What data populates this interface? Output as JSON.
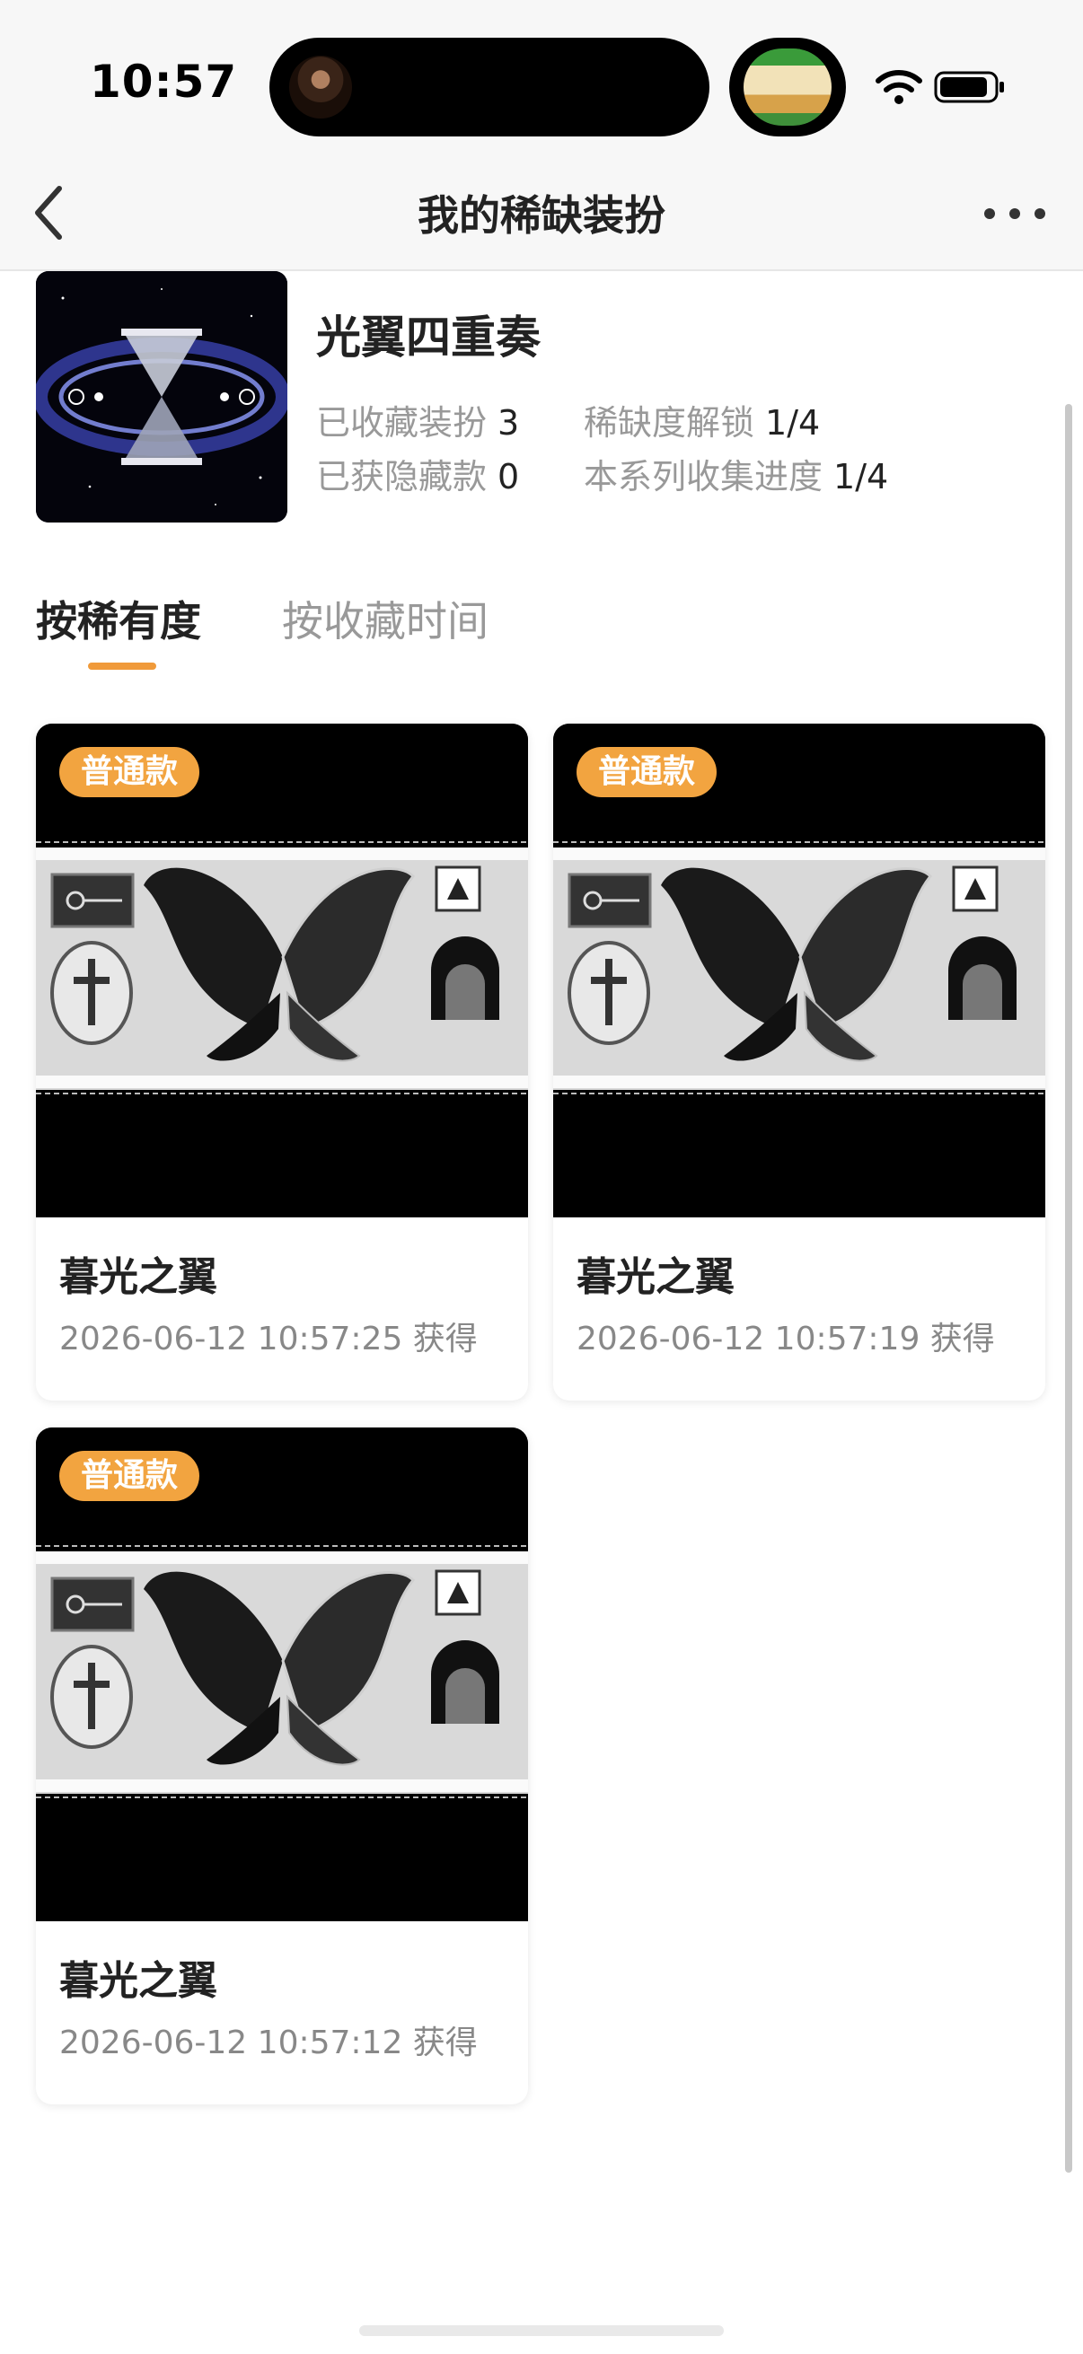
{
  "status_bar": {
    "time": "10:57",
    "icons": [
      "wifi-icon",
      "battery-icon"
    ]
  },
  "nav": {
    "title": "我的稀缺装扮",
    "back_icon": "chevron-left-icon",
    "more_icon": "more-icon"
  },
  "series": {
    "name": "光翼四重奏",
    "stats": [
      {
        "label": "已收藏装扮",
        "value": "3"
      },
      {
        "label": "稀缺度解锁",
        "value": "1/4"
      },
      {
        "label": "已获隐藏款",
        "value": "0"
      },
      {
        "label": "本系列收集进度",
        "value": "1/4"
      }
    ]
  },
  "tabs": [
    {
      "label": "按稀有度",
      "active": true
    },
    {
      "label": "按收藏时间",
      "active": false
    }
  ],
  "items": [
    {
      "badge": "普通款",
      "title": "暮光之翼",
      "date": "2026-06-12 10:57:25 获得"
    },
    {
      "badge": "普通款",
      "title": "暮光之翼",
      "date": "2026-06-12 10:57:19 获得"
    },
    {
      "badge": "普通款",
      "title": "暮光之翼",
      "date": "2026-06-12 10:57:12 获得"
    }
  ],
  "colors": {
    "accent": "#f09a3a",
    "badge_bg": "#f2a440",
    "muted_text": "#999999"
  }
}
